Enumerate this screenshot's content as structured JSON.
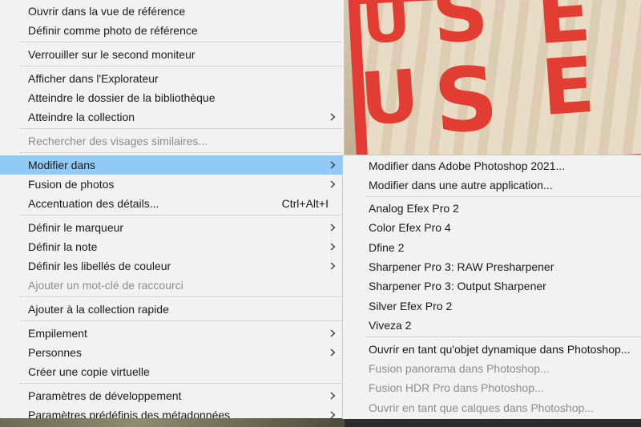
{
  "photo": {
    "letters": [
      "U",
      "S",
      "E",
      "U",
      "S",
      "E"
    ]
  },
  "menu": {
    "items": [
      {
        "label": "Ouvrir dans la vue de référence"
      },
      {
        "label": "Définir comme photo de référence"
      },
      {
        "label": "Verrouiller sur le second moniteur"
      },
      {
        "label": "Afficher dans l'Explorateur"
      },
      {
        "label": "Atteindre le dossier de la bibliothèque"
      },
      {
        "label": "Atteindre la collection"
      },
      {
        "label": "Rechercher des visages similaires..."
      },
      {
        "label": "Modifier dans"
      },
      {
        "label": "Fusion de photos"
      },
      {
        "label": "Accentuation des détails...",
        "shortcut": "Ctrl+Alt+I"
      },
      {
        "label": "Définir le marqueur"
      },
      {
        "label": "Définir la note"
      },
      {
        "label": "Définir les libellés de couleur"
      },
      {
        "label": "Ajouter un mot-clé de raccourci"
      },
      {
        "label": "Ajouter à la collection rapide"
      },
      {
        "label": "Empilement"
      },
      {
        "label": "Personnes"
      },
      {
        "label": "Créer une copie virtuelle"
      },
      {
        "label": "Paramètres de développement"
      },
      {
        "label": "Paramètres prédéfinis des métadonnées"
      }
    ]
  },
  "submenu": {
    "items": [
      {
        "label": "Modifier dans Adobe Photoshop 2021..."
      },
      {
        "label": "Modifier dans une autre application..."
      },
      {
        "label": "Analog Efex Pro 2"
      },
      {
        "label": "Color Efex Pro 4"
      },
      {
        "label": "Dfine 2"
      },
      {
        "label": "Sharpener Pro 3: RAW Presharpener"
      },
      {
        "label": "Sharpener Pro 3: Output Sharpener"
      },
      {
        "label": "Silver Efex Pro 2"
      },
      {
        "label": "Viveza 2"
      },
      {
        "label": "Ouvrir en tant qu'objet dynamique dans Photoshop..."
      },
      {
        "label": "Fusion panorama dans Photoshop..."
      },
      {
        "label": "Fusion HDR Pro dans Photoshop..."
      },
      {
        "label": "Ouvrir en tant que calques dans Photoshop..."
      }
    ]
  },
  "colors": {
    "menu_background": "#f2f2f2",
    "highlight": "#91c9f7",
    "disabled_text": "#8c8c8c",
    "text": "#1a1a1a"
  },
  "icons": {
    "submenu_arrow": "chevron-right-icon"
  }
}
